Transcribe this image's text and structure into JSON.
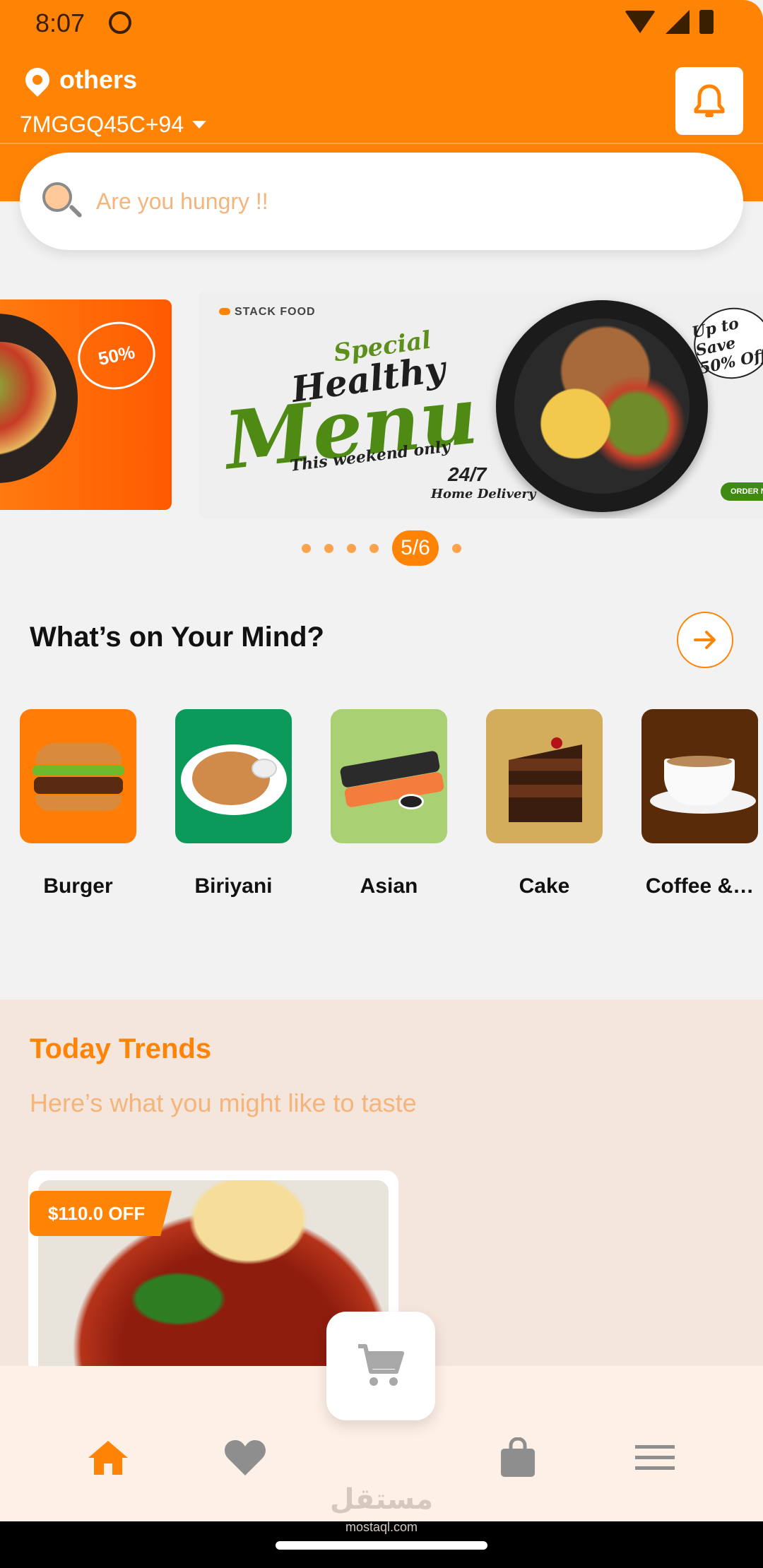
{
  "status_bar": {
    "time": "8:07"
  },
  "location": {
    "name": "others",
    "code": "7MGGQ45C+94"
  },
  "search": {
    "placeholder": "Are you hungry !!"
  },
  "banner": {
    "left_badge": "50%",
    "brand": "STACK FOOD",
    "special": "Special",
    "healthy": "Healthy",
    "menu": "Menu",
    "weekend": "This weekend only",
    "delivery_hours": "24/7",
    "delivery_text": "Home Delivery",
    "badge": "Up to Save 50% Off",
    "order_button": "ORDER N",
    "pager": "5/6"
  },
  "categories": {
    "title": "What’s on Your Mind?",
    "items": [
      {
        "label": "Burger",
        "bg": "#ff7d06"
      },
      {
        "label": "Biriyani",
        "bg": "#0c9a5a"
      },
      {
        "label": "Asian",
        "bg": "#a9d072"
      },
      {
        "label": "Cake",
        "bg": "#d4ad5c"
      },
      {
        "label": "Coffee &…",
        "bg": "#5a2b08"
      }
    ]
  },
  "trends": {
    "title": "Today Trends",
    "subtitle": "Here’s what you might like to taste",
    "discount": "$110.0 OFF"
  },
  "nav": {
    "active": "home"
  },
  "watermark": {
    "arabic": "مستقل",
    "english": "mostaql.com"
  },
  "colors": {
    "accent": "#ff8406",
    "accent_light": "#f5b479",
    "trend_bg": "#f4e5dd"
  }
}
